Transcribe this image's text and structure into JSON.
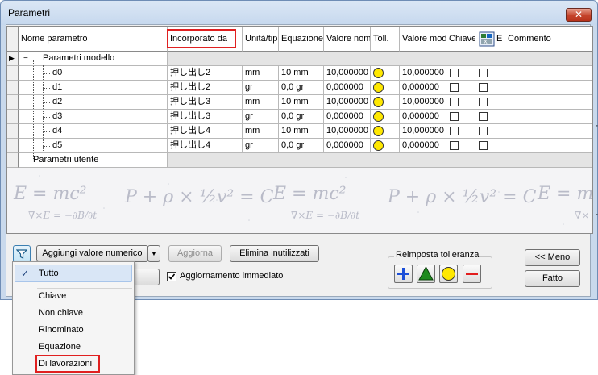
{
  "window": {
    "title": "Parametri",
    "close_symbol": "✕"
  },
  "grid": {
    "columns": [
      {
        "key": "name",
        "label": "Nome parametro"
      },
      {
        "key": "incorp",
        "label": "Incorporato da"
      },
      {
        "key": "unit",
        "label": "Unità/tip"
      },
      {
        "key": "eq",
        "label": "Equazione"
      },
      {
        "key": "nom",
        "label": "Valore nom"
      },
      {
        "key": "tol",
        "label": "Toll."
      },
      {
        "key": "mod",
        "label": "Valore mod"
      },
      {
        "key": "key",
        "label": "Chiave"
      },
      {
        "key": "e",
        "label": "E"
      },
      {
        "key": "comment",
        "label": "Commento"
      }
    ],
    "row_marker": "▶",
    "group_model": "Parametri modello",
    "group_user": "Parametri utente",
    "rows": [
      {
        "name": "d0",
        "incorp": "押し出し2",
        "unit": "mm",
        "eq": "10 mm",
        "nom": "10,000000",
        "mod": "10,000000"
      },
      {
        "name": "d1",
        "incorp": "押し出し2",
        "unit": "gr",
        "eq": "0,0 gr",
        "nom": "0,000000",
        "mod": "0,000000"
      },
      {
        "name": "d2",
        "incorp": "押し出し3",
        "unit": "mm",
        "eq": "10 mm",
        "nom": "10,000000",
        "mod": "10,000000"
      },
      {
        "name": "d3",
        "incorp": "押し出し3",
        "unit": "gr",
        "eq": "0,0 gr",
        "nom": "0,000000",
        "mod": "0,000000"
      },
      {
        "name": "d4",
        "incorp": "押し出し4",
        "unit": "mm",
        "eq": "10 mm",
        "nom": "10,000000",
        "mod": "10,000000"
      },
      {
        "name": "d5",
        "incorp": "押し出し4",
        "unit": "gr",
        "eq": "0,0 gr",
        "nom": "0,000000",
        "mod": "0,000000"
      }
    ]
  },
  "toolbar": {
    "filter_icon": "filter-icon",
    "add_numeric": "Aggiungi valore numerico",
    "update": "Aggiorna",
    "delete_unused": "Elimina inutilizzati",
    "immediate_update": "Aggiornamento immediato",
    "tolerance_group": "Reimposta tolleranza",
    "less": "<< Meno",
    "done": "Fatto"
  },
  "menu": {
    "checked_item": "Tutto",
    "check_mark": "✓",
    "items": [
      "Chiave",
      "Non chiave",
      "Rinominato",
      "Equazione",
      "Di lavorazioni"
    ]
  },
  "colors": {
    "highlight": "#e02020",
    "tol_yellow": "#ffe800",
    "tol_green": "#1f8a1f",
    "tol_blue": "#1c4fd8",
    "tol_red": "#e21d1d"
  }
}
